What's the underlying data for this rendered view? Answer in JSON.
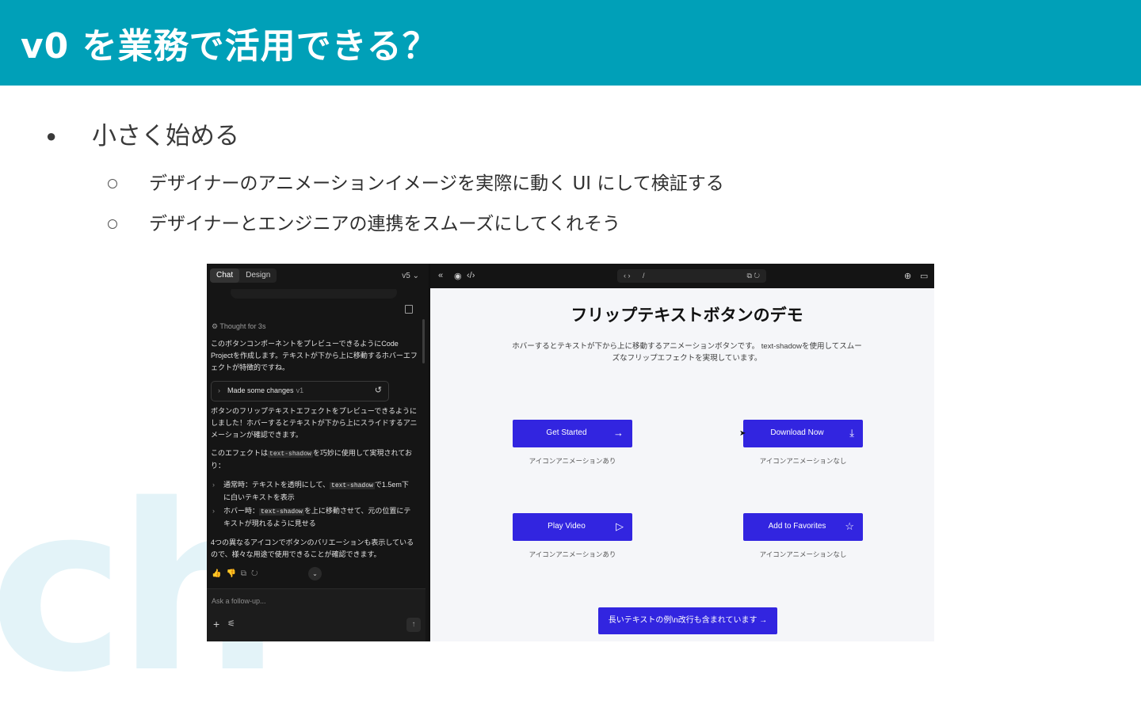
{
  "slide": {
    "title": "v0 を業務で活用できる？",
    "bullet_main": "小さく始める",
    "sub_bullets": [
      "デザイナーのアニメーションイメージを実際に動く UI にして検証する",
      "デザイナーとエンジニアの連携をスムーズにしてくれそう"
    ],
    "watermark": "ch"
  },
  "chat": {
    "tabs": [
      "Chat",
      "Design"
    ],
    "version": "v5 ⌄",
    "faded_text": "Show full message",
    "thought": "Thought for 3s",
    "para1": "このボタンコンポーネントをプレビューできるようにCode Projectを作成します。テキストが下から上に移動するホバーエフェクトが特徴的ですね。",
    "changes_label": "Made some changes",
    "changes_version": "v1",
    "para2": "ボタンのフリップテキストエフェクトをプレビューできるようにしました！ホバーするとテキストが下から上にスライドするアニメーションが確認できます。",
    "para3_pre": "このエフェクトは",
    "para3_code": "text-shadow",
    "para3_post": "を巧妙に使用して実現されており：",
    "li1_pre": "通常時：テキストを透明にして、",
    "li1_code": "text-shadow",
    "li1_post": "で1.5em下に白いテキストを表示",
    "li2_pre": "ホバー時：",
    "li2_code": "text-shadow",
    "li2_post": "を上に移動させて、元の位置にテキストが現れるように見せる",
    "para4": "4つの異なるアイコンでボタンのバリエーションも表示しているので、様々な用途で使用できることが確認できます。",
    "input_placeholder": "Ask a follow-up..."
  },
  "toolbar": {
    "url": "/"
  },
  "preview": {
    "title": "フリップテキストボタンのデモ",
    "description": "ホバーするとテキストが下から上に移動するアニメーションボタンです。 text-shadowを使用してスムーズなフリップエフェクトを実現しています。",
    "buttons": [
      {
        "label": "Get Started",
        "icon": "arrow-right-icon",
        "caption": "アイコンアニメーションあり"
      },
      {
        "label": "Download Now",
        "icon": "download-icon",
        "caption": "アイコンアニメーションなし"
      },
      {
        "label": "Play Video",
        "icon": "play-icon",
        "caption": "アイコンアニメーションあり"
      },
      {
        "label": "Add to Favorites",
        "icon": "star-icon",
        "caption": "アイコンアニメーションなし"
      }
    ],
    "long_button": "長いテキストの例\\n改行も含まれています →"
  },
  "colors": {
    "header": "#00a0b8",
    "button": "#3225e0",
    "watermark": "#e3f3f8"
  }
}
